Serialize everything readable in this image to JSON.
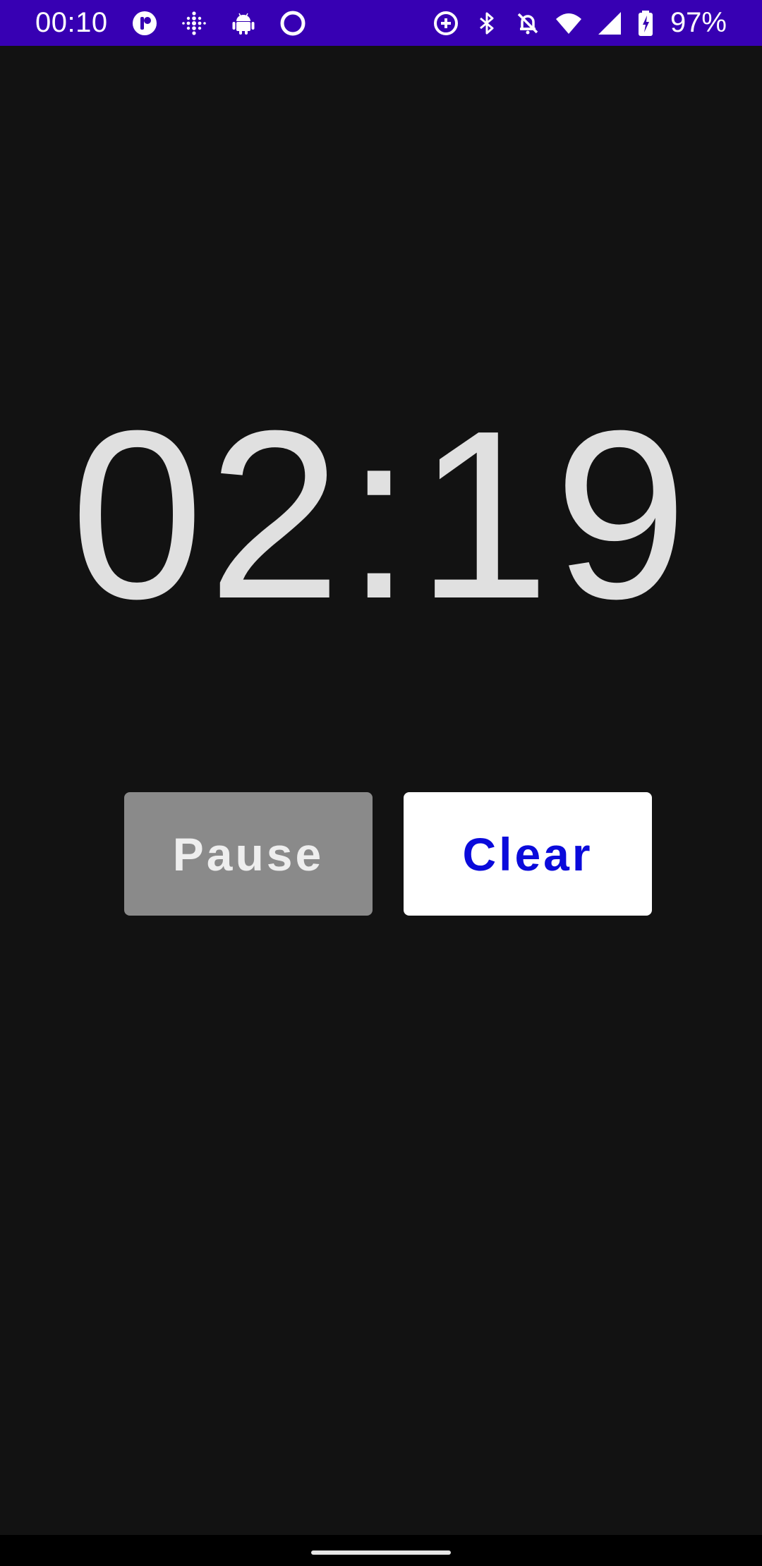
{
  "status_bar": {
    "time": "00:10",
    "battery_percent": "97%",
    "left_icons": [
      "app-badge-icon",
      "fitbit-icon",
      "android-icon",
      "circle-icon"
    ],
    "right_icons": [
      "data-saver-icon",
      "bluetooth-icon",
      "alarm-off-icon",
      "wifi-icon",
      "signal-icon",
      "battery-icon"
    ],
    "background_color": "#3700b3"
  },
  "timer": {
    "display": "02:19",
    "text_color": "#e0e0e0"
  },
  "controls": {
    "pause_label": "Pause",
    "clear_label": "Clear",
    "pause_bg": "#8a8a8a",
    "clear_bg": "#ffffff",
    "clear_text_color": "#0a0adb"
  },
  "nav_bar": {
    "icon": "home-handle"
  }
}
